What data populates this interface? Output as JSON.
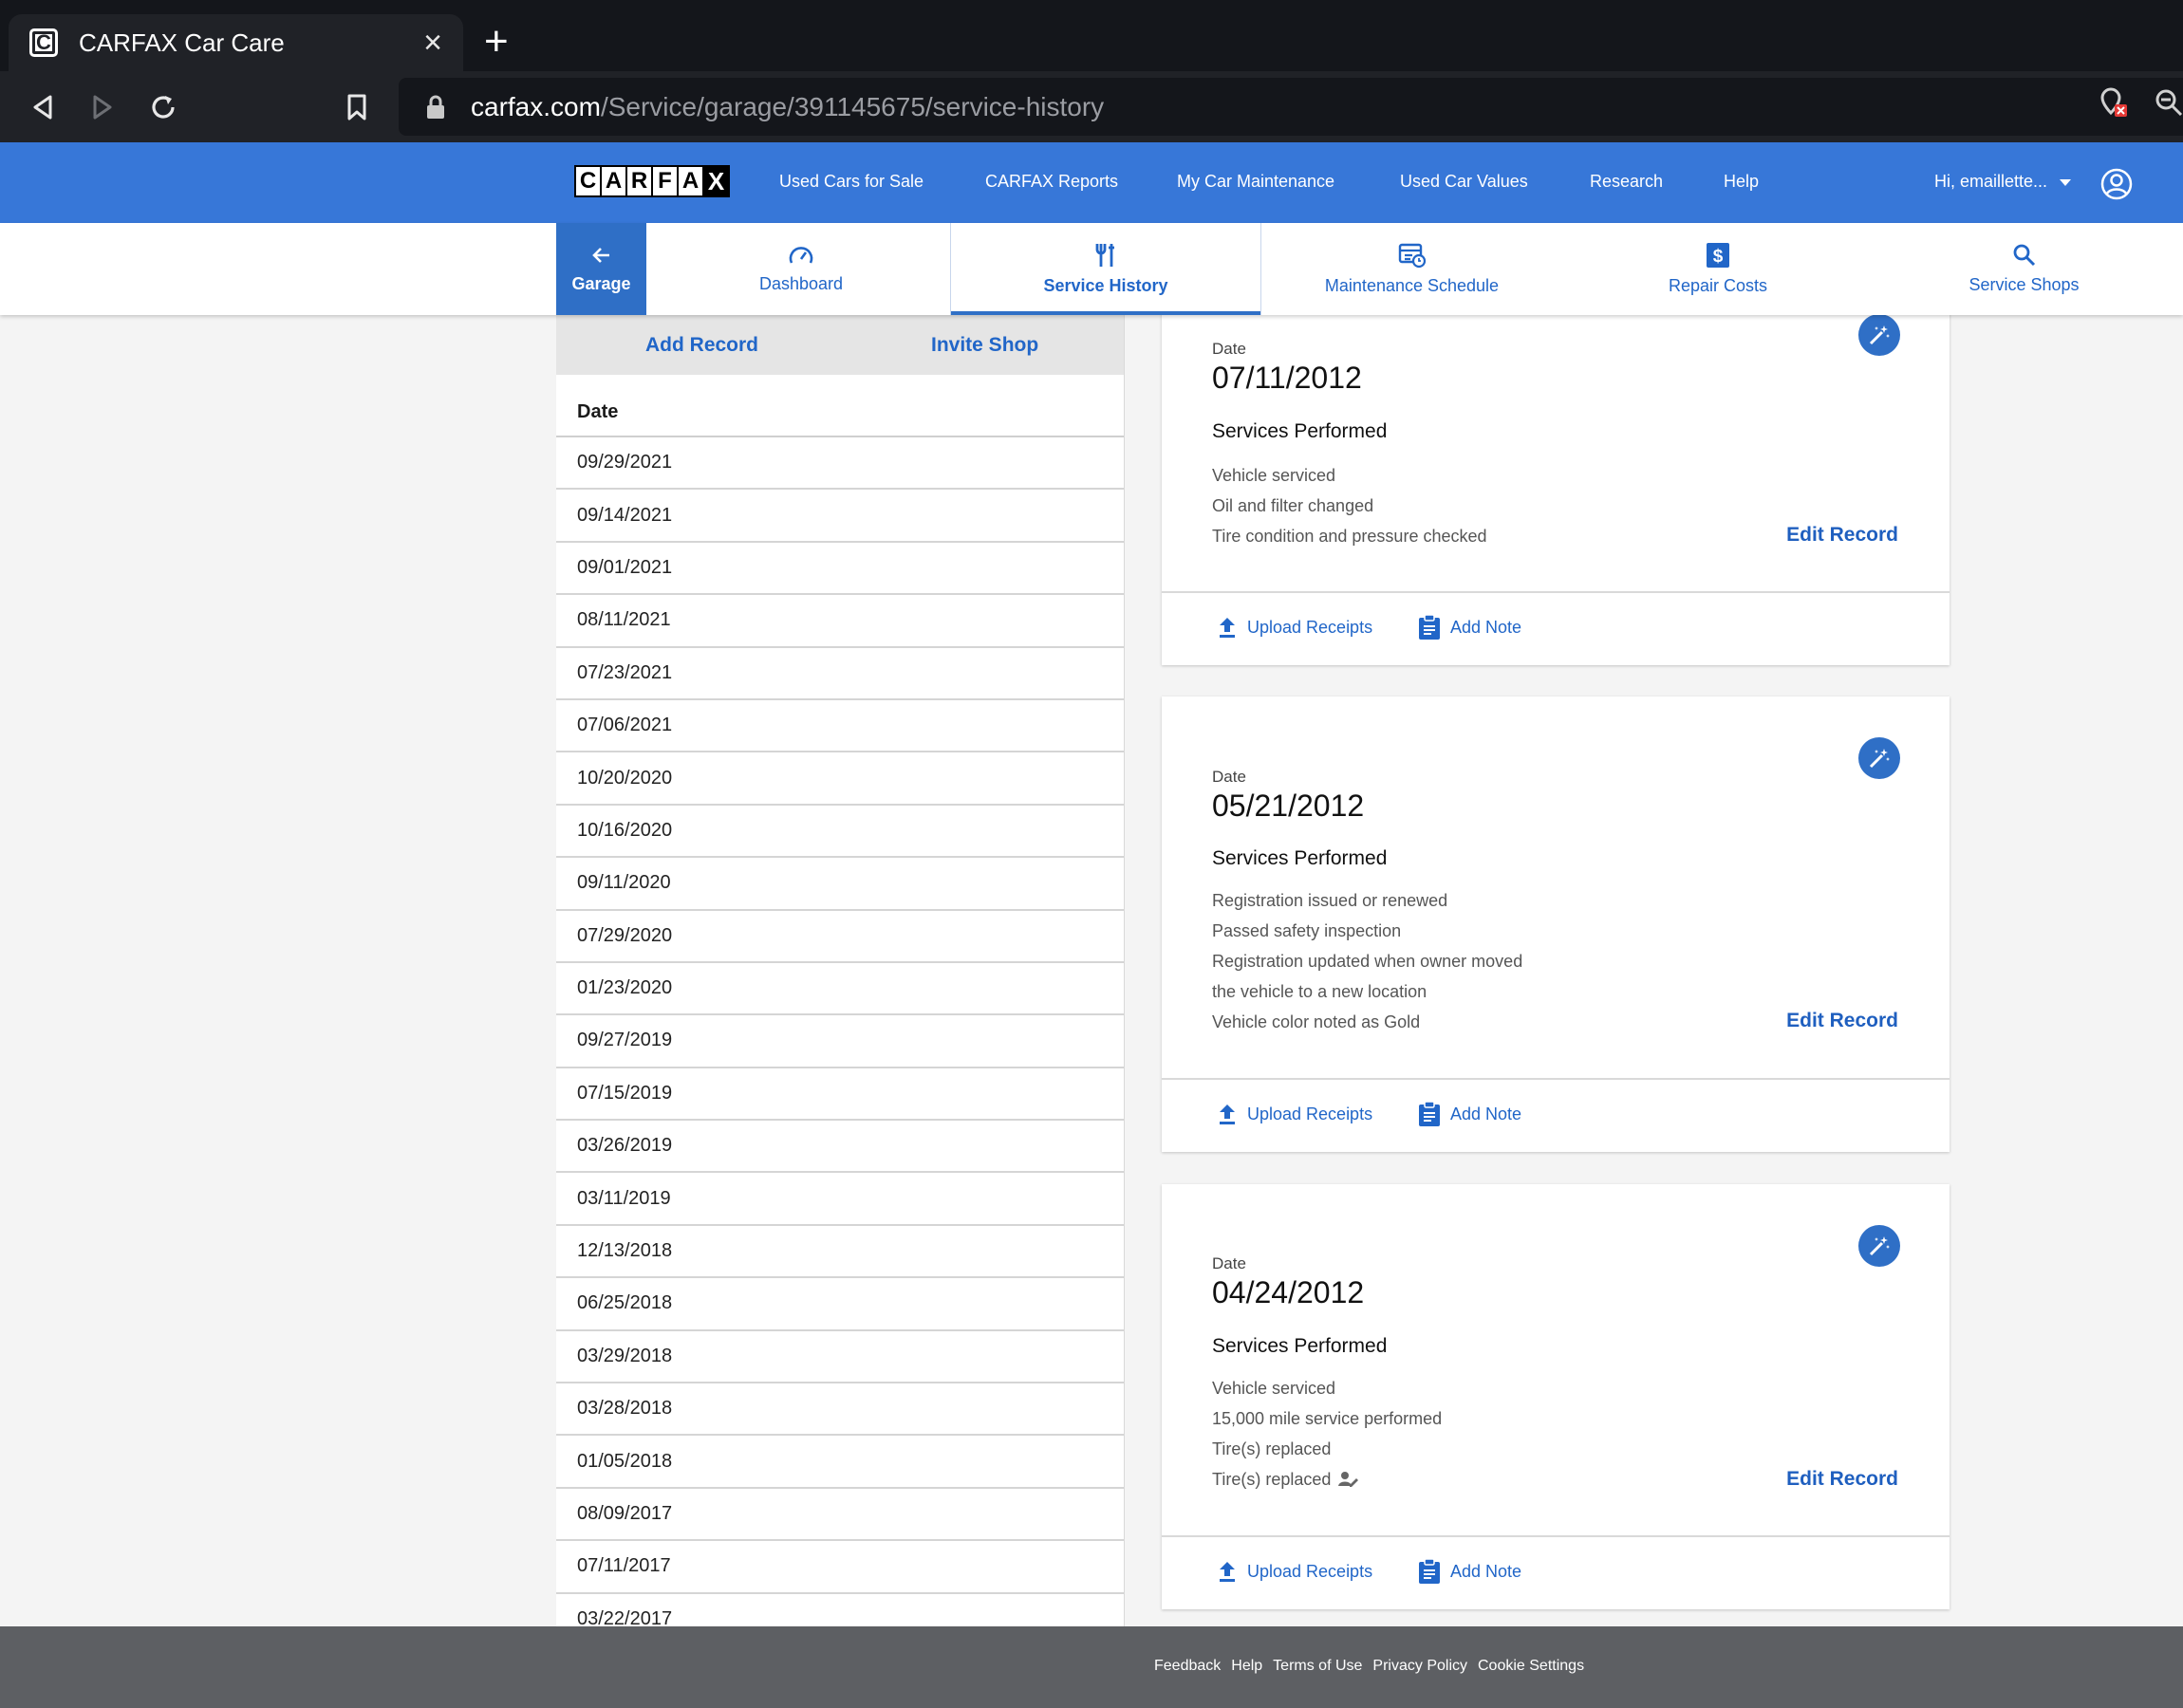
{
  "browser": {
    "tab_title": "CARFAX Car Care",
    "url_host": "carfax.com",
    "url_path": "/Service/garage/391145675/service-history"
  },
  "header": {
    "logo_letters": [
      "C",
      "A",
      "R",
      "F",
      "A",
      "X"
    ],
    "nav": [
      "Used Cars for Sale",
      "CARFAX Reports",
      "My Car Maintenance",
      "Used Car Values",
      "Research",
      "Help"
    ],
    "user_greeting": "Hi, emaillette..."
  },
  "subnav": {
    "garage": "Garage",
    "dashboard": "Dashboard",
    "service_history": "Service History",
    "maintenance_schedule": "Maintenance Schedule",
    "repair_costs": "Repair Costs",
    "service_shops": "Service Shops"
  },
  "left_panel": {
    "add_record": "Add Record",
    "invite_shop": "Invite Shop",
    "date_header": "Date",
    "dates": [
      "09/29/2021",
      "09/14/2021",
      "09/01/2021",
      "08/11/2021",
      "07/23/2021",
      "07/06/2021",
      "10/20/2020",
      "10/16/2020",
      "09/11/2020",
      "07/29/2020",
      "01/23/2020",
      "09/27/2019",
      "07/15/2019",
      "03/26/2019",
      "03/11/2019",
      "12/13/2018",
      "06/25/2018",
      "03/29/2018",
      "03/28/2018",
      "01/05/2018",
      "08/09/2017",
      "07/11/2017",
      "03/22/2017"
    ]
  },
  "cards": [
    {
      "date_label": "Date",
      "date": "07/11/2012",
      "services_title": "Services Performed",
      "services": [
        "Vehicle serviced",
        "Oil and filter changed",
        "Tire condition and pressure checked"
      ],
      "edit_label": "Edit Record",
      "upload_label": "Upload Receipts",
      "note_label": "Add Note"
    },
    {
      "date_label": "Date",
      "date": "05/21/2012",
      "services_title": "Services Performed",
      "services": [
        "Registration issued or renewed",
        "Passed safety inspection",
        "Registration updated when owner moved",
        "the vehicle to a new location",
        "Vehicle color noted as Gold"
      ],
      "edit_label": "Edit Record",
      "upload_label": "Upload Receipts",
      "note_label": "Add Note"
    },
    {
      "date_label": "Date",
      "date": "04/24/2012",
      "services_title": "Services Performed",
      "services": [
        "Vehicle serviced",
        "15,000 mile service performed",
        "Tire(s) replaced",
        "Tire(s) replaced"
      ],
      "edit_label": "Edit Record",
      "upload_label": "Upload Receipts",
      "note_label": "Add Note"
    }
  ],
  "footer": {
    "links": [
      "Feedback",
      "Help",
      "Terms of Use",
      "Privacy Policy",
      "Cookie Settings"
    ]
  }
}
